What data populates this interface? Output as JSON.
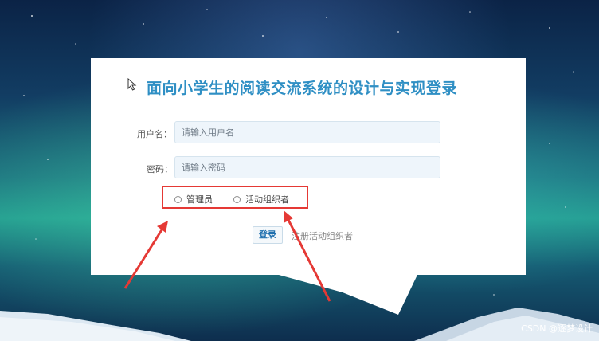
{
  "page": {
    "title": "面向小学生的阅读交流系统的设计与实现登录"
  },
  "form": {
    "username_label": "用户名：",
    "username_placeholder": "请输入用户名",
    "password_label": "密码：",
    "password_placeholder": "请输入密码",
    "roles": [
      {
        "label": "管理员",
        "selected": false
      },
      {
        "label": "活动组织者",
        "selected": false
      }
    ],
    "login_label": "登录",
    "register_label": "注册活动组织者"
  },
  "icons": {
    "cursor": "mouse-pointer-icon"
  },
  "annotation": {
    "highlight_color": "#e53935"
  },
  "watermark": "CSDN @逐梦设计",
  "colors": {
    "title": "#2f8fc4",
    "panel": "#ffffff",
    "input_bg": "#eef5fb"
  }
}
